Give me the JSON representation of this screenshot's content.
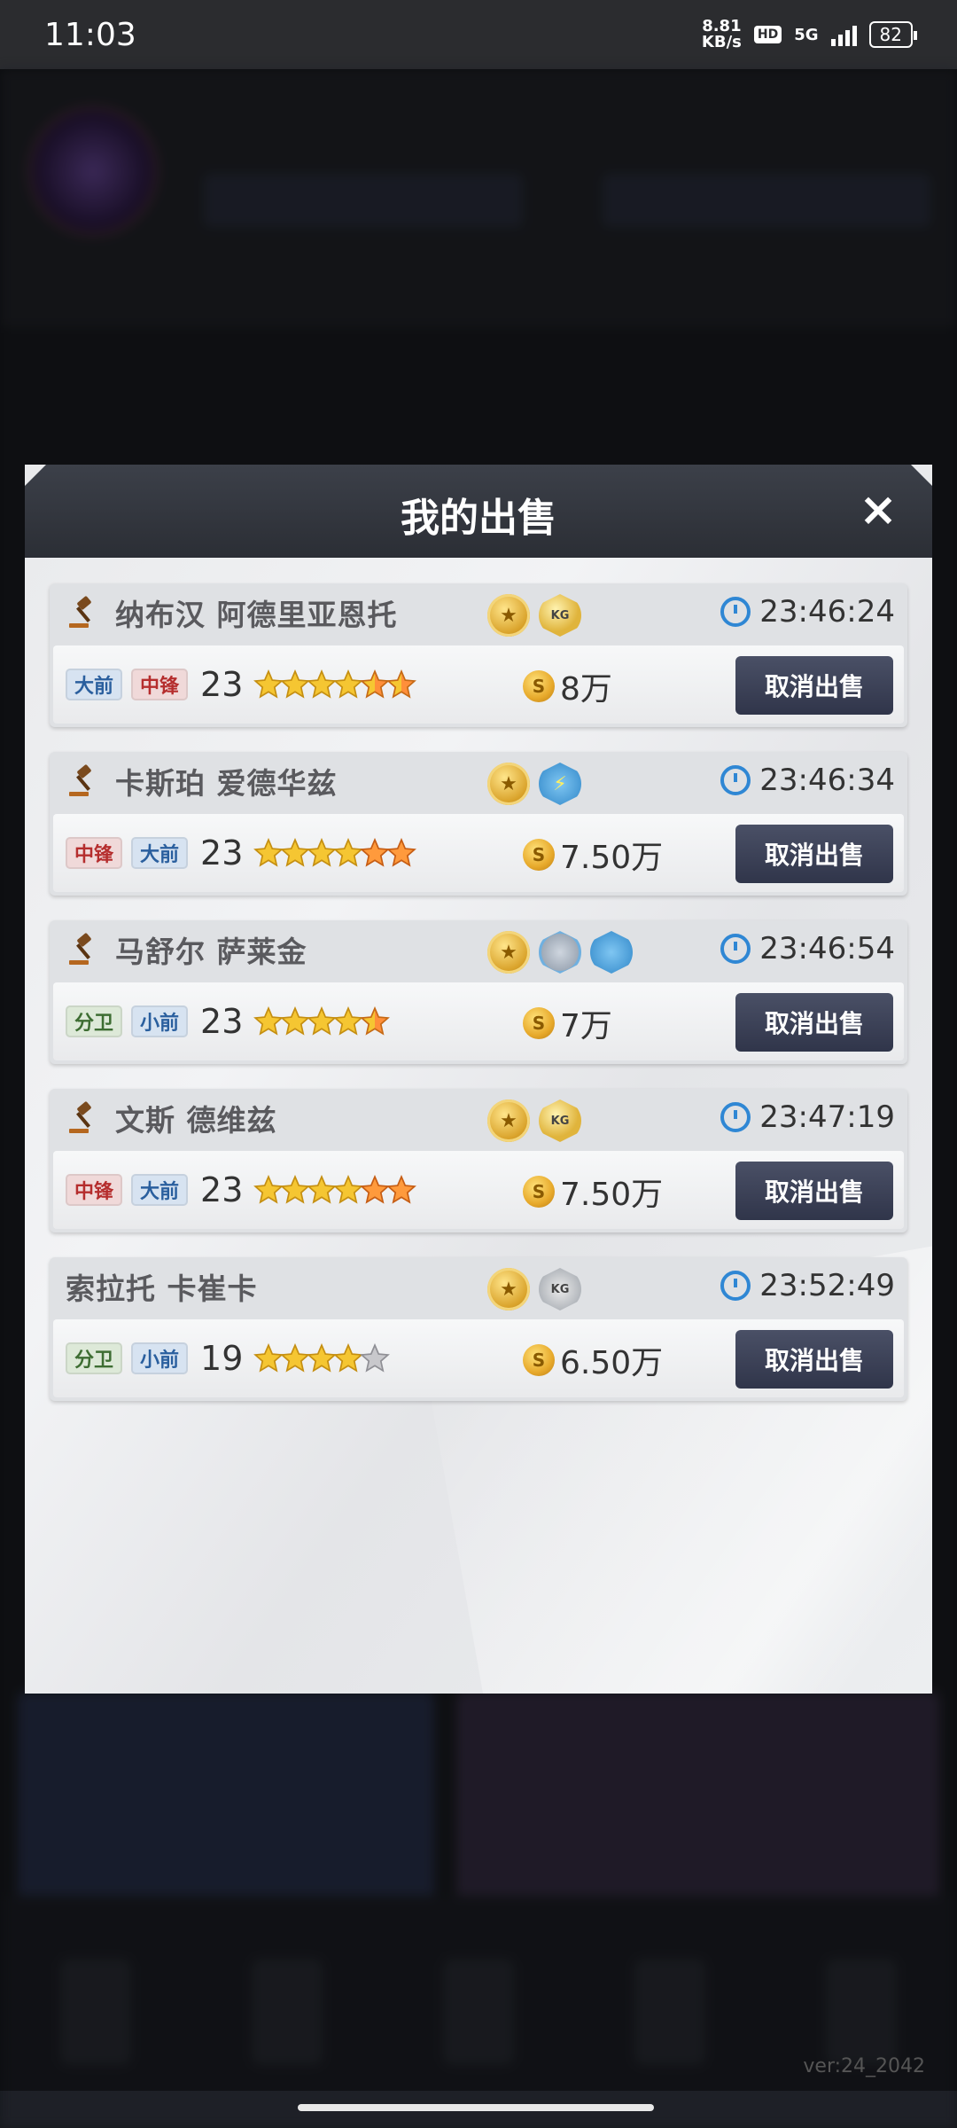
{
  "status_bar": {
    "time": "11:03",
    "net_speed_value": "8.81",
    "net_speed_unit": "KB/s",
    "hd": "HD",
    "network": "5G",
    "battery": "82"
  },
  "background": {
    "version": "ver:24_2042"
  },
  "modal": {
    "title": "我的出售",
    "close_glyph": "×",
    "cancel_label": "取消出售",
    "listings": [
      {
        "name": "纳布汉 阿德里亚恩托",
        "show_gavel": true,
        "badges": [
          {
            "icon": "gold-medal"
          },
          {
            "icon": "kg",
            "text": "KG"
          }
        ],
        "timer": "23:46:24",
        "positions": [
          {
            "label": "大前",
            "color": "blue"
          },
          {
            "label": "中锋",
            "color": "red"
          }
        ],
        "level": "23",
        "stars": [
          1,
          1,
          1,
          1,
          0.5,
          0.5
        ],
        "price": "8万"
      },
      {
        "name": "卡斯珀 爱德华兹",
        "show_gavel": true,
        "badges": [
          {
            "icon": "gold-medal"
          },
          {
            "icon": "lightning"
          }
        ],
        "timer": "23:46:34",
        "positions": [
          {
            "label": "中锋",
            "color": "red"
          },
          {
            "label": "大前",
            "color": "blue"
          }
        ],
        "level": "23",
        "stars": [
          1,
          1,
          1,
          1,
          2,
          2
        ],
        "price": "7.50万"
      },
      {
        "name": "马舒尔 萨莱金",
        "show_gavel": true,
        "badges": [
          {
            "icon": "gold-medal"
          },
          {
            "icon": "gray-shield"
          },
          {
            "icon": "player-blue"
          }
        ],
        "timer": "23:46:54",
        "positions": [
          {
            "label": "分卫",
            "color": "green"
          },
          {
            "label": "小前",
            "color": "blue"
          }
        ],
        "level": "23",
        "stars": [
          1,
          1,
          1,
          1,
          0.5
        ],
        "price": "7万"
      },
      {
        "name": "文斯 德维兹",
        "show_gavel": true,
        "badges": [
          {
            "icon": "gold-medal"
          },
          {
            "icon": "kg",
            "text": "KG"
          }
        ],
        "timer": "23:47:19",
        "positions": [
          {
            "label": "中锋",
            "color": "red"
          },
          {
            "label": "大前",
            "color": "blue"
          }
        ],
        "level": "23",
        "stars": [
          1,
          1,
          1,
          1,
          2,
          2
        ],
        "price": "7.50万"
      },
      {
        "name": "索拉托 卡崔卡",
        "show_gavel": false,
        "badges": [
          {
            "icon": "gold-medal"
          },
          {
            "icon": "silver-kg",
            "text": "KG"
          }
        ],
        "timer": "23:52:49",
        "positions": [
          {
            "label": "分卫",
            "color": "green"
          },
          {
            "label": "小前",
            "color": "blue"
          }
        ],
        "level": "19",
        "stars": [
          1,
          1,
          1,
          1,
          0
        ],
        "price": "6.50万"
      }
    ]
  }
}
